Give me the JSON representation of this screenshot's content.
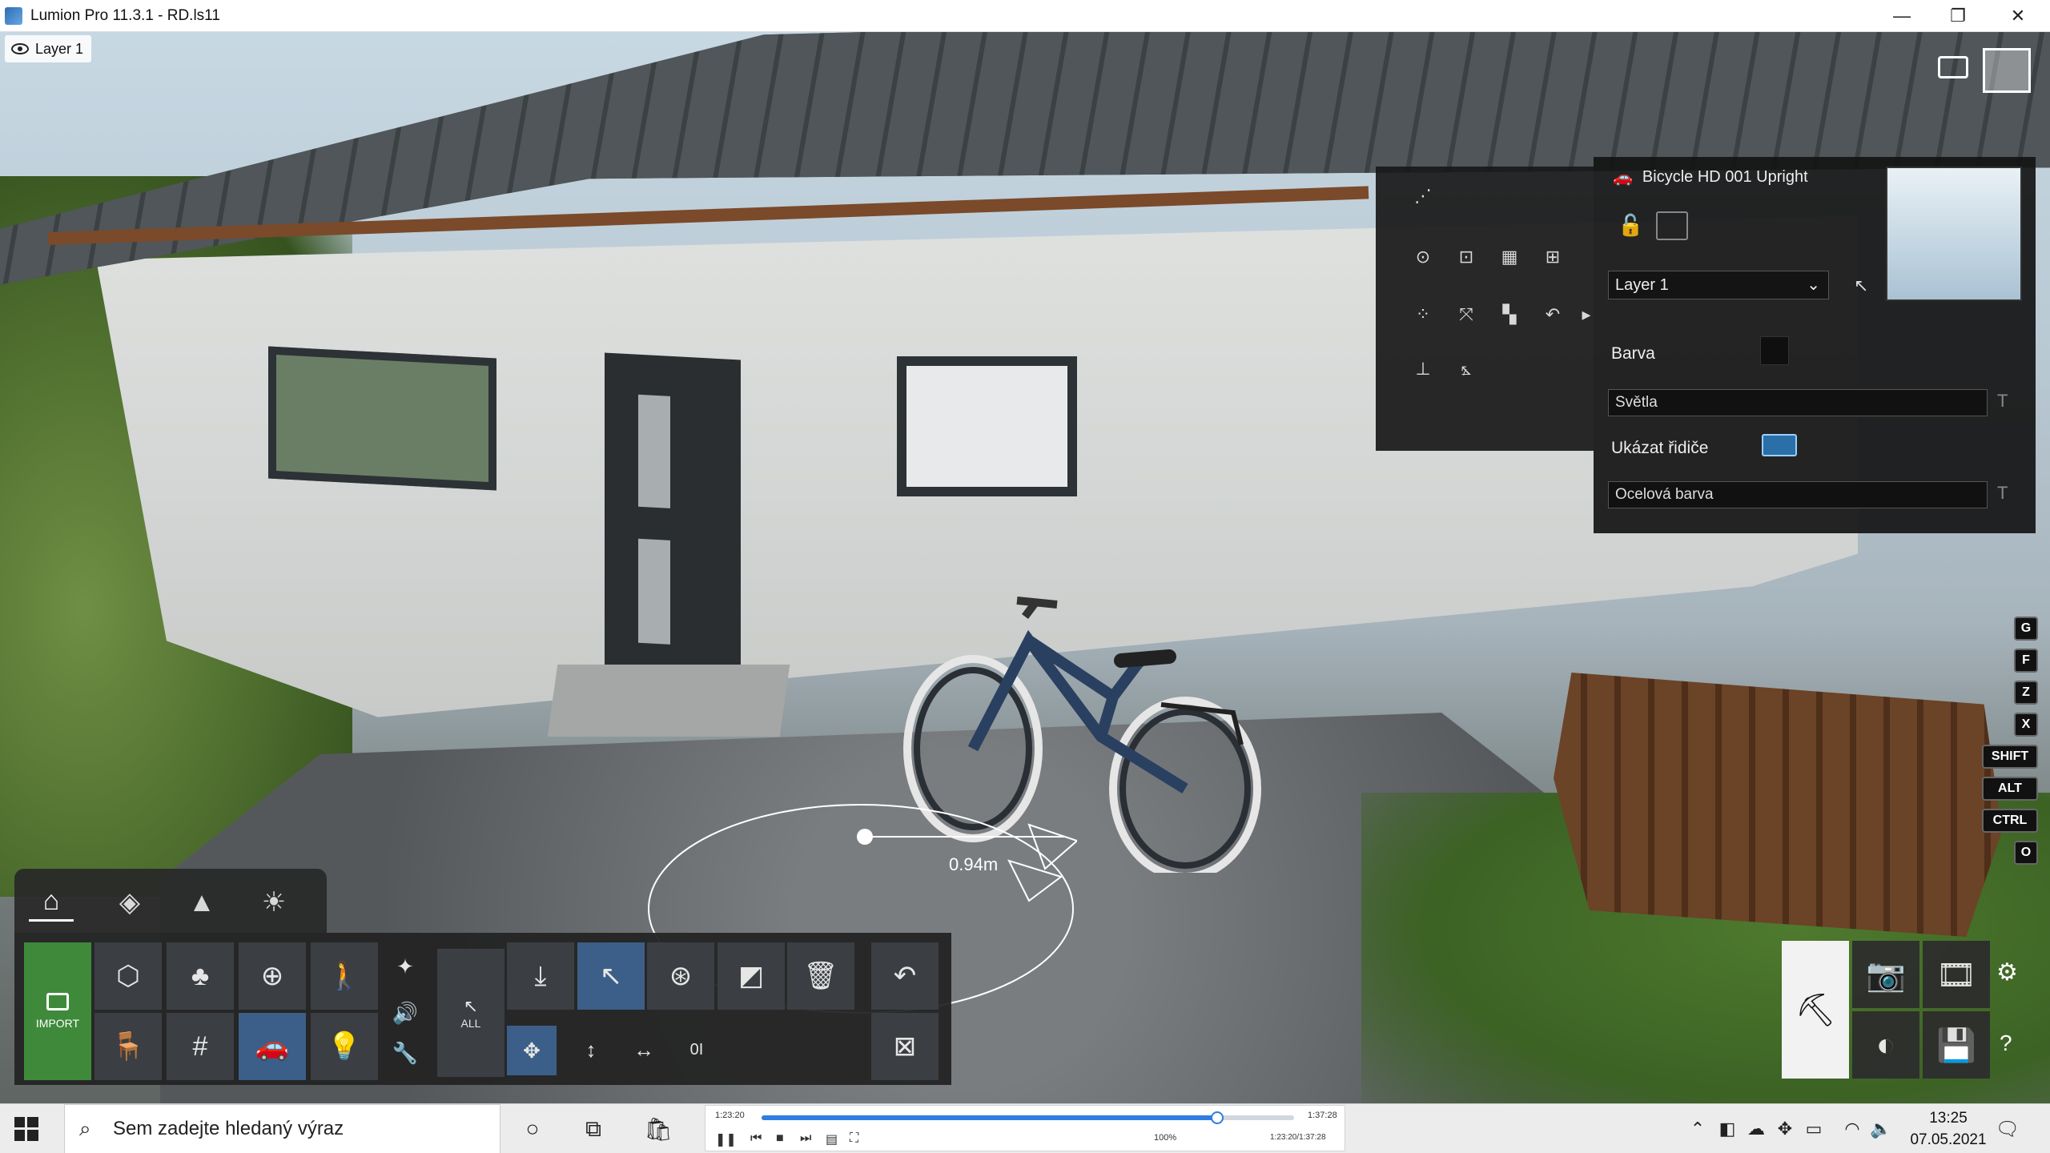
{
  "window": {
    "title": "Lumion Pro 11.3.1  - RD.ls11",
    "minimize_glyph": "—",
    "restore_glyph": "❐",
    "close_glyph": "✕"
  },
  "viewport": {
    "layer_indicator": "Layer 1",
    "distance_label": "0.94m"
  },
  "properties": {
    "object_name": "Bicycle HD 001 Upright",
    "layer_select": "Layer 1",
    "rows": [
      {
        "label": "Barva"
      },
      {
        "field": "Světla"
      },
      {
        "label": "Ukázat řidiče",
        "toggle": true
      },
      {
        "field": "Ocelová barva"
      }
    ],
    "t_glyph": "T"
  },
  "modifier_keys": [
    "G",
    "F",
    "Z",
    "X",
    "SHIFT",
    "ALT",
    "CTRL",
    "O"
  ],
  "toolbar": {
    "import_label": "IMPORT",
    "all_label": "ALL",
    "value_label": "0I"
  },
  "taskbar": {
    "search_placeholder": "Sem zadejte hledaný výraz",
    "time": "13:25",
    "date": "07.05.2021"
  },
  "player": {
    "elapsed": "1:23:20",
    "total": "1:37:28",
    "volume": "100%",
    "position_readout": "1:23:20/1:37:28",
    "progress": 0.855
  },
  "colors": {
    "accent_blue": "#3b5f88",
    "import_green": "#3f8a3a",
    "player_blue": "#2f7de1"
  }
}
